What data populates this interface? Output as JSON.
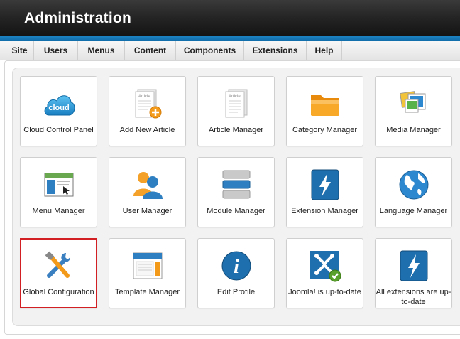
{
  "header": {
    "title": "Administration"
  },
  "menu": {
    "items": [
      {
        "label": "Site"
      },
      {
        "label": "Users"
      },
      {
        "label": "Menus"
      },
      {
        "label": "Content"
      },
      {
        "label": "Components"
      },
      {
        "label": "Extensions"
      },
      {
        "label": "Help"
      }
    ]
  },
  "tiles": [
    {
      "label": "Cloud Control Panel",
      "icon": "cloud-icon",
      "icon_text": "cloud"
    },
    {
      "label": "Add New Article",
      "icon": "add-article-icon",
      "icon_text": "Article"
    },
    {
      "label": "Article Manager",
      "icon": "article-manager-icon",
      "icon_text": "Article"
    },
    {
      "label": "Category Manager",
      "icon": "folder-icon"
    },
    {
      "label": "Media Manager",
      "icon": "media-icon"
    },
    {
      "label": "Menu Manager",
      "icon": "menu-window-icon"
    },
    {
      "label": "User Manager",
      "icon": "users-icon"
    },
    {
      "label": "Module Manager",
      "icon": "module-stack-icon"
    },
    {
      "label": "Extension Manager",
      "icon": "lightning-icon"
    },
    {
      "label": "Language Manager",
      "icon": "globe-icon"
    },
    {
      "label": "Global Configuration",
      "icon": "tools-icon",
      "selected": true
    },
    {
      "label": "Template Manager",
      "icon": "template-icon"
    },
    {
      "label": "Edit Profile",
      "icon": "info-icon",
      "icon_text": "i"
    },
    {
      "label": "Joomla! is up-to-date",
      "icon": "joomla-check-icon"
    },
    {
      "label": "All extensions are up-to-date",
      "icon": "lightning-icon"
    }
  ],
  "colors": {
    "header_bg": "#1e1e1e",
    "accent_blue": "#1a7fc1",
    "selected_border": "#d21f24",
    "folder_orange": "#f59c1a",
    "success_green": "#5aa02c"
  }
}
